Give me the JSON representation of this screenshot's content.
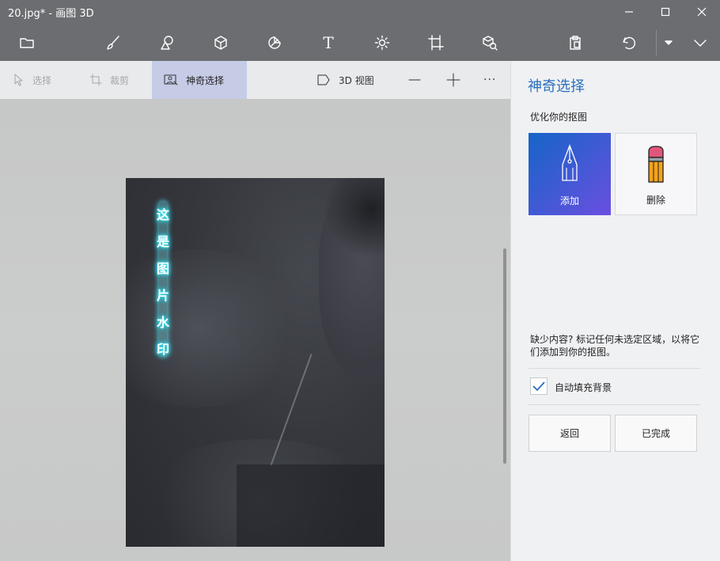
{
  "window": {
    "title": "20.jpg* - 画图 3D"
  },
  "toolbar": {
    "items": [
      "folder-icon",
      "brush-icon",
      "shapes-2d-icon",
      "shapes-3d-icon",
      "stickers-icon",
      "text-icon",
      "effects-icon",
      "canvas-icon",
      "library-3d-icon",
      "paste-icon",
      "undo-icon",
      "dropdown-icon",
      "expand-icon"
    ],
    "text_glyph": "T"
  },
  "subtoolbar": {
    "select_label": "选择",
    "crop_label": "裁剪",
    "magic_select_label": "神奇选择",
    "view3d_label": "3D 视图",
    "more_label": "···"
  },
  "canvas": {
    "watermark_chars": [
      "这",
      "是",
      "图",
      "片",
      "水",
      "印"
    ]
  },
  "panel": {
    "title": "神奇选择",
    "subtitle": "优化你的抠图",
    "add_label": "添加",
    "delete_label": "删除",
    "hint": "缺少内容? 标记任何未选定区域，以将它们添加到你的抠图。",
    "autofill_label": "自动填充背景",
    "autofill_checked": true,
    "back_label": "返回",
    "done_label": "已完成"
  },
  "colors": {
    "accent": "#2a6fbf",
    "titlebar": "#6b6d71",
    "add_gradient_start": "#1565c8",
    "add_gradient_end": "#6a4fe0",
    "glow": "#36e3f0"
  }
}
